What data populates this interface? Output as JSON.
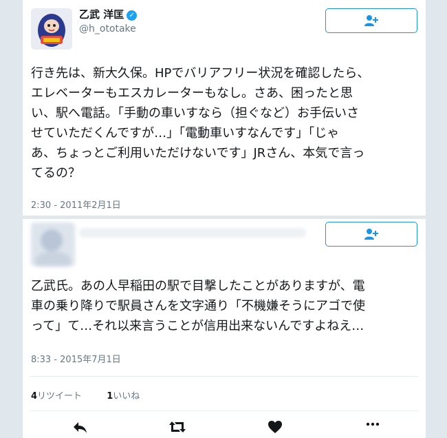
{
  "tweets": [
    {
      "user": {
        "name": "乙武 洋匡",
        "handle": "@h_ototake",
        "verified": true
      },
      "text": "行き先は、新大久保。HPでバリアフリー状況を確認したら、\nエレベーターもエスカレーターもなし。さあ、困ったと思\nい、駅へ電話。「手動の車いすなら（担ぐなど）お手伝いさ\nせていただくんですが…」「電動車いすなんです」「じゃ\nあ、ちょっとご利用いただけないです」JRさん、本気で言っ\nてるの？",
      "timestamp": "2:30 - 2011年2月1日"
    },
    {
      "text": "乙武氏。あの人早稲田の駅で目撃したことがありますが、電\n車の乗り降りで駅員さんを文字通り「不機嫌そうにアゴで使\nって」て…それ以来言うことが信用出来ないんですよねえ…",
      "timestamp": "8:33 - 2015年7月1日",
      "stats": {
        "retweets_count": "4",
        "retweets_label": "リツイート",
        "likes_count": "1",
        "likes_label": "いいね"
      }
    }
  ],
  "icons": [
    "follow-icon",
    "verified-icon",
    "reply-icon",
    "retweet-icon",
    "like-icon",
    "more-icon"
  ],
  "colors": {
    "accent": "#1b95e0",
    "verified": "#1da1f2",
    "secondary_text": "#657786",
    "background": "#e1e8ed"
  }
}
